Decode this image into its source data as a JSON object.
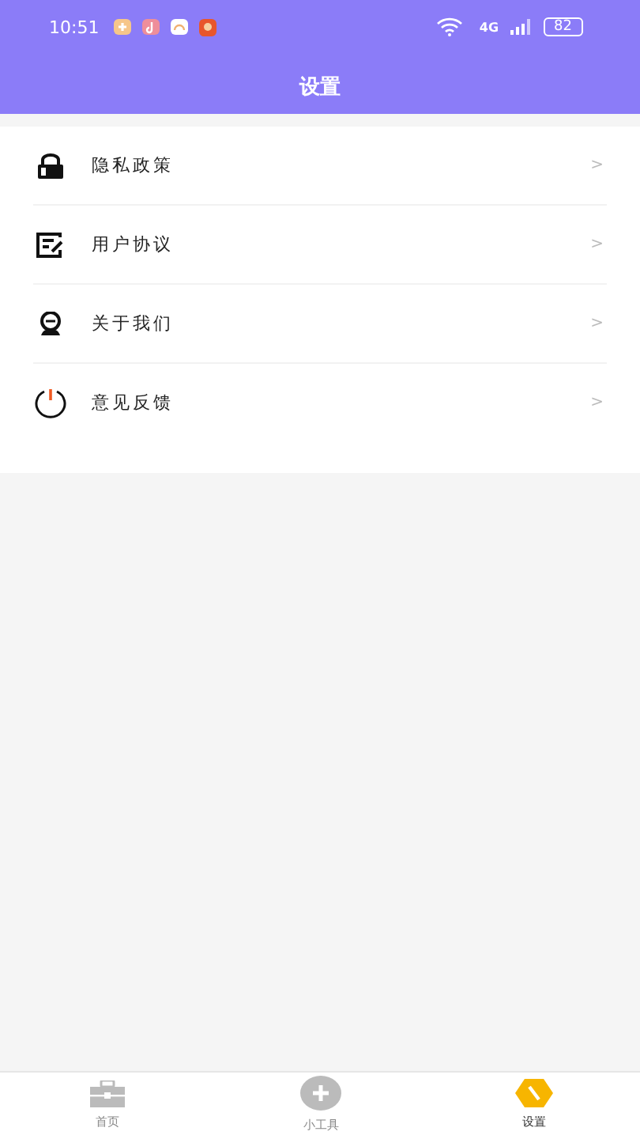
{
  "status_bar": {
    "time": "10:51",
    "network": "4G",
    "battery": "82"
  },
  "header": {
    "title": "设置"
  },
  "menu": [
    {
      "kind": "lock",
      "label": "隐私政策",
      "chevron": ">"
    },
    {
      "kind": "edit",
      "label": "用户协议",
      "chevron": ">"
    },
    {
      "kind": "person",
      "label": "关于我们",
      "chevron": ">"
    },
    {
      "kind": "power",
      "label": "意见反馈",
      "chevron": ">"
    }
  ],
  "tab_bar": [
    {
      "kind": "toolbox",
      "label": "首页",
      "selected": false
    },
    {
      "kind": "plus",
      "label": "小工具",
      "selected": false
    },
    {
      "kind": "hexagon",
      "label": "设置",
      "selected": true
    }
  ]
}
